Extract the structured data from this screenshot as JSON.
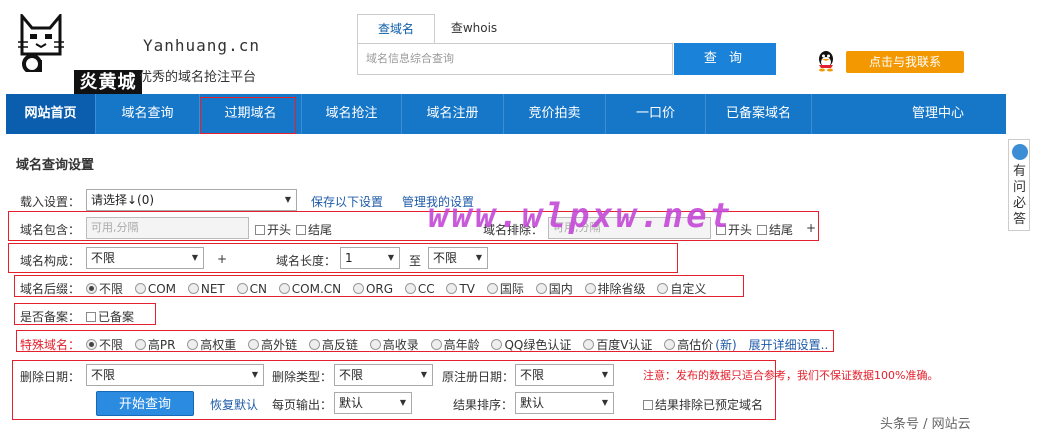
{
  "header": {
    "brand": "炎黄城",
    "site_en": "Yanhuang.cn",
    "slogan": "优秀的域名抢注平台",
    "search_tabs": [
      "查域名",
      "查whois"
    ],
    "search_placeholder": "域名信息综合查询",
    "search_button": "查 询",
    "contact_button": "点击与我联系"
  },
  "nav": {
    "items": [
      "网站首页",
      "域名查询",
      "过期域名",
      "域名抢注",
      "域名注册",
      "竞价拍卖",
      "一口价",
      "已备案域名",
      "管理中心"
    ]
  },
  "sidebar": {
    "text": "有问必答"
  },
  "panel": {
    "title": "域名查询设置",
    "load_label": "载入设置：",
    "load_value": "请选择↓(0)",
    "save_link": "保存以下设置",
    "manage_link": "管理我的设置",
    "contains_label": "域名包含：",
    "contains_placeholder": "可用,分隔",
    "start_label": "开头",
    "end_label": "结尾",
    "exclude_label": "域名排除：",
    "exclude_placeholder": "可用,分隔",
    "start2_label": "开头",
    "end2_label": "结尾",
    "plus": "+",
    "compose_label": "域名构成：",
    "compose_value": "不限",
    "length_label": "域名长度：",
    "length_from": "1",
    "to_label": "至",
    "length_to": "不限",
    "suffix_label": "域名后缀：",
    "suffix_options": [
      "不限",
      "COM",
      "NET",
      "CN",
      "COM.CN",
      "ORG",
      "CC",
      "TV",
      "国际",
      "国内",
      "排除省级",
      "自定义"
    ],
    "icp_label": "是否备案：",
    "icp_option": "已备案",
    "special_label": "特殊域名：",
    "special_options": [
      "不限",
      "高PR",
      "高权重",
      "高外链",
      "高反链",
      "高收录",
      "高年龄",
      "QQ绿色认证",
      "百度V认证",
      "高估价"
    ],
    "new_tag": "(新)",
    "expand_link": "展开详细设置..",
    "delete_date_label": "删除日期：",
    "delete_date_value": "不限",
    "delete_type_label": "删除类型：",
    "delete_type_value": "不限",
    "reg_date_label": "原注册日期：",
    "reg_date_value": "不限",
    "notice": "注意：发布的数据只适合参考，我们不保证数据100%准确。",
    "start_button": "开始查询",
    "reset_link": "恢复默认",
    "per_page_label": "每页输出：",
    "per_page_value": "默认",
    "sort_label": "结果排序：",
    "sort_value": "默认",
    "exclude_reserved": "结果排除已预定域名"
  },
  "watermark": "www.wlpxw.net",
  "credit": "头条号 / 网站云",
  "colors": {
    "nav": "#1677c9",
    "nav_active": "#0b5eae",
    "highlight": "#e4202c",
    "contact": "#f39800",
    "link": "#1e5aa8"
  }
}
